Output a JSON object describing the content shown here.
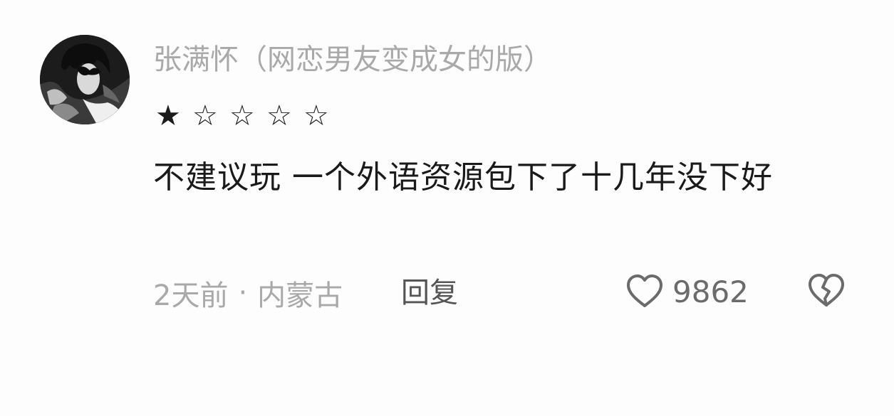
{
  "comment": {
    "username": "张满怀（网恋男友变成女的版）",
    "rating": {
      "value": 1,
      "max": 5,
      "stars": [
        "★",
        "☆",
        "☆",
        "☆",
        "☆"
      ]
    },
    "text": "不建议玩 一个外语资源包下了十几年没下好",
    "time": "2天前",
    "separator": "·",
    "location": "内蒙古",
    "reply_label": "回复",
    "likes": "9862",
    "icons": {
      "avatar": "avatar-image",
      "like": "heart-outline-icon",
      "dislike": "broken-heart-icon"
    }
  }
}
